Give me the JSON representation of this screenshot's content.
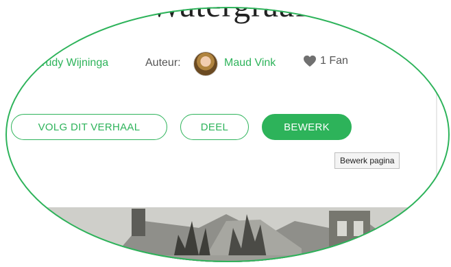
{
  "story": {
    "title_partial": "Watergraaf",
    "writer_partial": "Trudy Wijninga",
    "author_label": "Auteur:",
    "author_name": "Maud Vink",
    "fans": "1 Fan"
  },
  "actions": {
    "follow": "VOLG DIT VERHAAL",
    "share": "DEEL",
    "edit": "BEWERK"
  },
  "tooltip": {
    "text": "Bewerk pagina"
  },
  "colors": {
    "accent": "#2db35a",
    "text": "#555555",
    "outline": "#2db35a"
  },
  "icons": {
    "heart": "heart-icon",
    "avatar": "author-avatar"
  }
}
